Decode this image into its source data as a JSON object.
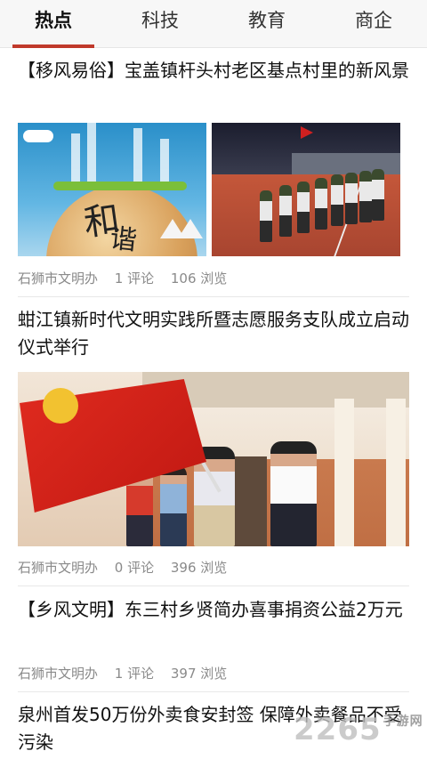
{
  "tabs": [
    {
      "label": "热点",
      "active": true
    },
    {
      "label": "科技",
      "active": false
    },
    {
      "label": "教育",
      "active": false
    },
    {
      "label": "商企",
      "active": false
    }
  ],
  "accent_color": "#c0392b",
  "articles": [
    {
      "title": "【移风易俗】宝盖镇杆头村老区基点村里的新风景",
      "source": "石狮市文明办",
      "comments": "1 评论",
      "views": "106 浏览",
      "image_text": "和谐"
    },
    {
      "title": "蚶江镇新时代文明实践所暨志愿服务支队成立启动仪式举行",
      "source": "石狮市文明办",
      "comments": "0 评论",
      "views": "396 浏览"
    },
    {
      "title": "【乡风文明】东三村乡贤简办喜事捐资公益2万元",
      "source": "石狮市文明办",
      "comments": "1 评论",
      "views": "397 浏览"
    },
    {
      "title": "泉州首发50万份外卖食安封签 保障外卖餐品不受污染"
    }
  ],
  "watermark": {
    "text": "2265",
    "suffix": "手游网"
  }
}
